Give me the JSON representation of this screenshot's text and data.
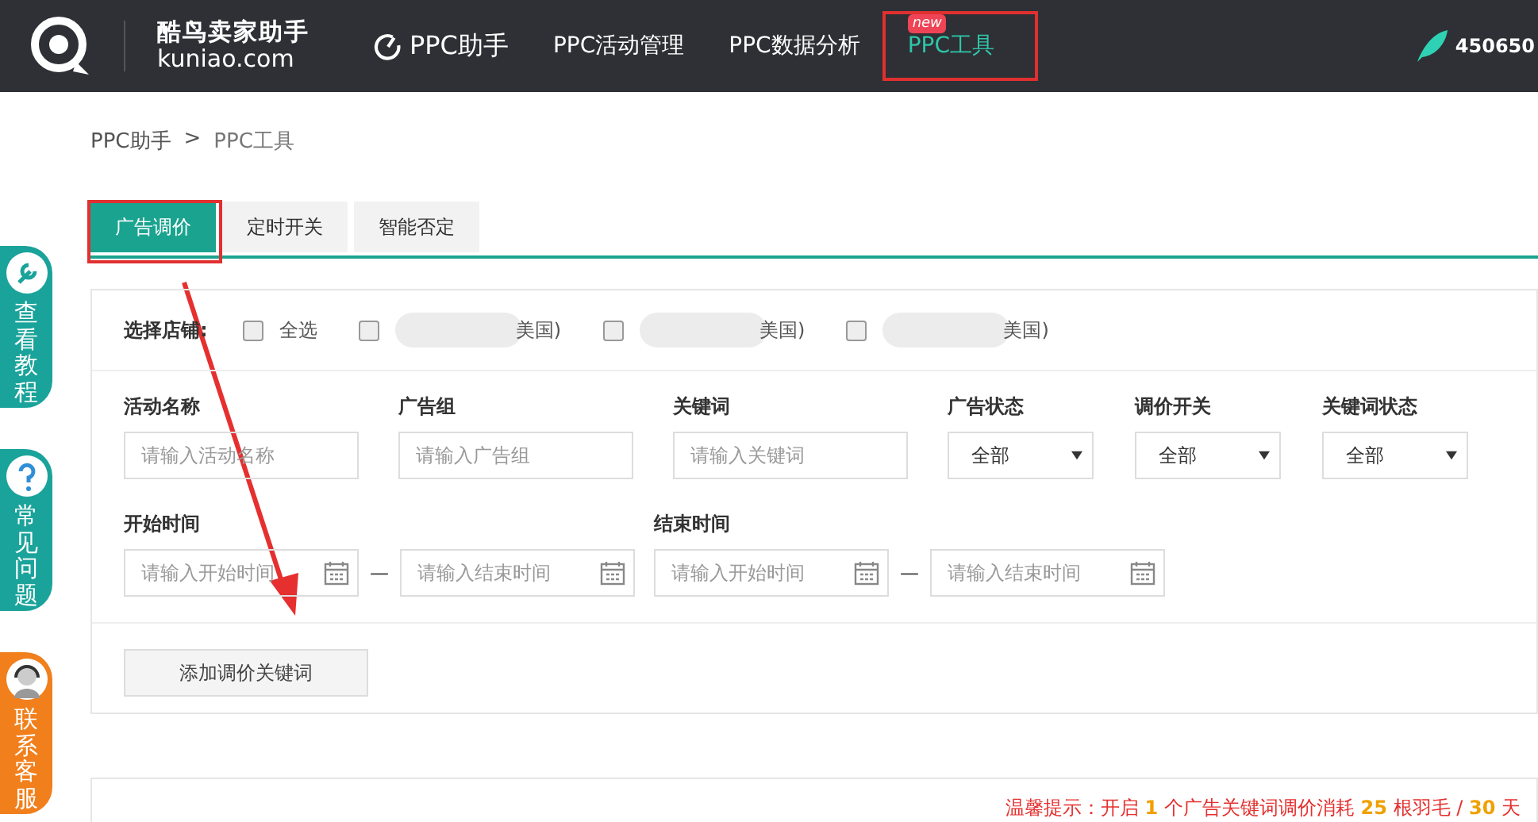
{
  "header": {
    "brand": "酷鸟卖家助手",
    "domain": "kuniao.com",
    "nav": [
      {
        "label": "PPC助手",
        "icon": true,
        "selected": false
      },
      {
        "label": "PPC活动管理",
        "icon": false,
        "selected": false
      },
      {
        "label": "PPC数据分析",
        "icon": false,
        "selected": false
      },
      {
        "label": "PPC工具",
        "icon": false,
        "selected": true,
        "badge": "new"
      }
    ],
    "balance": "450650"
  },
  "side_buttons": [
    {
      "label": "查看教程",
      "kind": "wrench",
      "color": "#1aa39a"
    },
    {
      "label": "常见问题",
      "kind": "question",
      "color": "#1aa39a"
    },
    {
      "label": "联系客服",
      "kind": "agent",
      "color": "#f07f1c"
    }
  ],
  "breadcrumb": [
    "PPC助手",
    ">",
    "PPC工具"
  ],
  "tabs": [
    {
      "label": "广告调价",
      "selected": true
    },
    {
      "label": "定时开关",
      "selected": false
    },
    {
      "label": "智能否定",
      "selected": false
    }
  ],
  "stores": {
    "label": "选择店铺:",
    "options": [
      {
        "label": "全选",
        "checked": false,
        "blurred": false
      },
      {
        "label": "美国)",
        "checked": false,
        "blurred": true
      },
      {
        "label": "美国)",
        "checked": false,
        "blurred": true
      },
      {
        "label": "美国)",
        "checked": false,
        "blurred": true
      }
    ]
  },
  "filters": [
    {
      "label": "活动名称",
      "kind": "input",
      "placeholder": "请输入活动名称"
    },
    {
      "label": "广告组",
      "kind": "input",
      "placeholder": "请输入广告组"
    },
    {
      "label": "关键词",
      "kind": "input",
      "placeholder": "请输入关键词"
    },
    {
      "label": "广告状态",
      "kind": "select",
      "value": "全部"
    },
    {
      "label": "调价开关",
      "kind": "select",
      "value": "全部"
    },
    {
      "label": "关键词状态",
      "kind": "select",
      "value": "全部"
    }
  ],
  "date_ranges": [
    {
      "label": "开始时间",
      "from": "请输入开始时间",
      "to": "请输入结束时间"
    },
    {
      "label": "结束时间",
      "from": "请输入开始时间",
      "to": "请输入结束时间"
    }
  ],
  "range_separator": "—",
  "add_button": "添加调价关键词",
  "notice": "温馨提示：开启 **1** 个广告关键词调价消耗 **25** 根羽毛 / **30** 天"
}
